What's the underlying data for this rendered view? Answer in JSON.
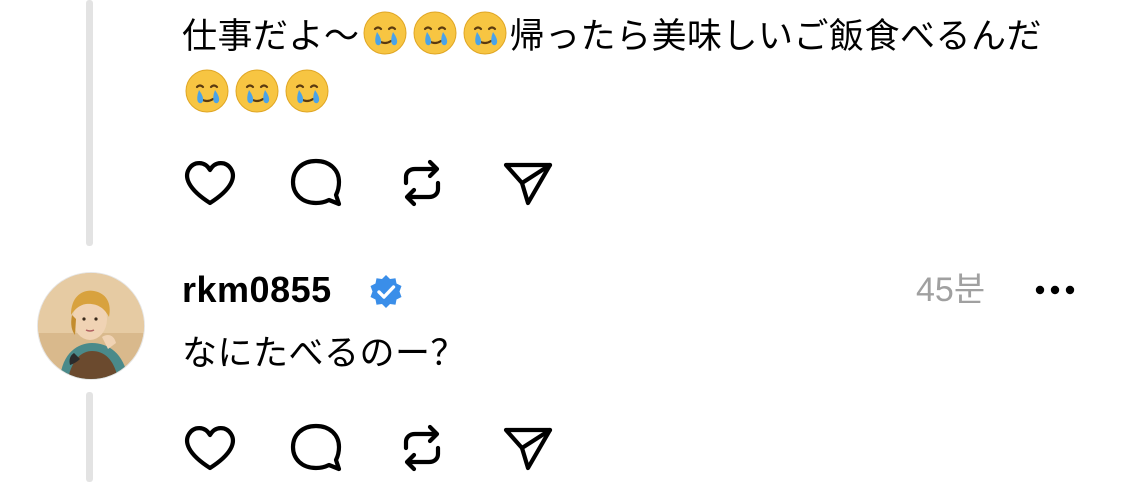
{
  "first_post": {
    "text_part1": "仕事だよ～",
    "text_part2": "帰ったら美味しいご飯食べるんだ",
    "emoji_icon": "face-holding-back-tears-icon",
    "emoji_count_inline": 3,
    "emoji_count_trailing": 3
  },
  "actions": {
    "like_icon": "heart-icon",
    "reply_icon": "comment-bubble-icon",
    "repost_icon": "repost-icon",
    "share_icon": "send-paper-plane-icon"
  },
  "reply_post": {
    "username": "rkm0855",
    "verified_icon": "verified-badge-icon",
    "timestamp": "45분",
    "more_icon": "more-dots-icon",
    "text": "なにたべるのー？"
  },
  "colors": {
    "verified_blue": "#3a8ee9",
    "timestamp_gray": "#a0a0a0",
    "thread_line": "#e3e3e3"
  }
}
